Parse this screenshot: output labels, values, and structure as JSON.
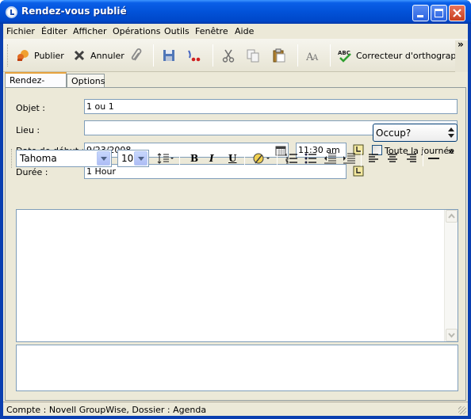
{
  "window": {
    "title": "Rendez-vous publié"
  },
  "menu": [
    "Fichier",
    "Éditer",
    "Afficher",
    "Opérations",
    "Outils",
    "Fenêtre",
    "Aide"
  ],
  "toolbar": {
    "publish_label": "Publier",
    "cancel_label": "Annuler",
    "spell_label": "Correcteur d'orthographe",
    "overflow": "»"
  },
  "tabs": [
    "Rendez-vous",
    "Options"
  ],
  "form": {
    "subject_label": "Objet :",
    "subject_value": "1 ou 1",
    "place_label": "Lieu :",
    "place_value": "",
    "start_label": "Date de début :",
    "start_date": "9/23/2008",
    "start_time": "11:30 am",
    "allday_label": "Toute la journée",
    "duration_label": "Durée :",
    "duration_value": "1 Hour",
    "show_as": "Occup?"
  },
  "format": {
    "font": "Tahoma",
    "size": "10",
    "bold": "B",
    "italic": "I",
    "underline": "U",
    "overflow": "»"
  },
  "statusbar": {
    "text": "Compte : Novell GroupWise,  Dossier : Agenda"
  },
  "colors": {
    "titlebar": "#0252d8",
    "chrome": "#ece9d8",
    "field_border": "#7f9db9",
    "active_tab": "#e7a33d"
  }
}
